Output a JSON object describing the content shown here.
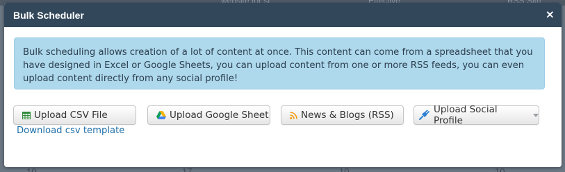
{
  "background": {
    "ghost_top": [
      "website for st",
      "Effective",
      "RSS Site"
    ],
    "ghost_bottom": [
      "10",
      "17",
      "10",
      "10"
    ]
  },
  "modal": {
    "title": "Bulk Scheduler",
    "close_glyph": "×",
    "info_text": "Bulk scheduling allows creation of a lot of content at once. This content can come from a spreadsheet that you have designed in Excel or Google Sheets, you can upload content from one or more RSS feeds, you can even upload content directly from any social profile!",
    "buttons": {
      "csv": {
        "label": "Upload CSV File",
        "icon": "spreadsheet-icon"
      },
      "google": {
        "label": "Upload Google Sheet",
        "icon": "google-drive-icon"
      },
      "rss": {
        "label": "News & Blogs (RSS)",
        "icon": "rss-icon"
      },
      "social": {
        "label": "Upload Social Profile",
        "icon": "plug-icon"
      }
    },
    "download_link": "Download csv template"
  },
  "colors": {
    "header_bg": "#33475b",
    "info_bg": "#aed8ec",
    "link": "#1f6fa8"
  }
}
